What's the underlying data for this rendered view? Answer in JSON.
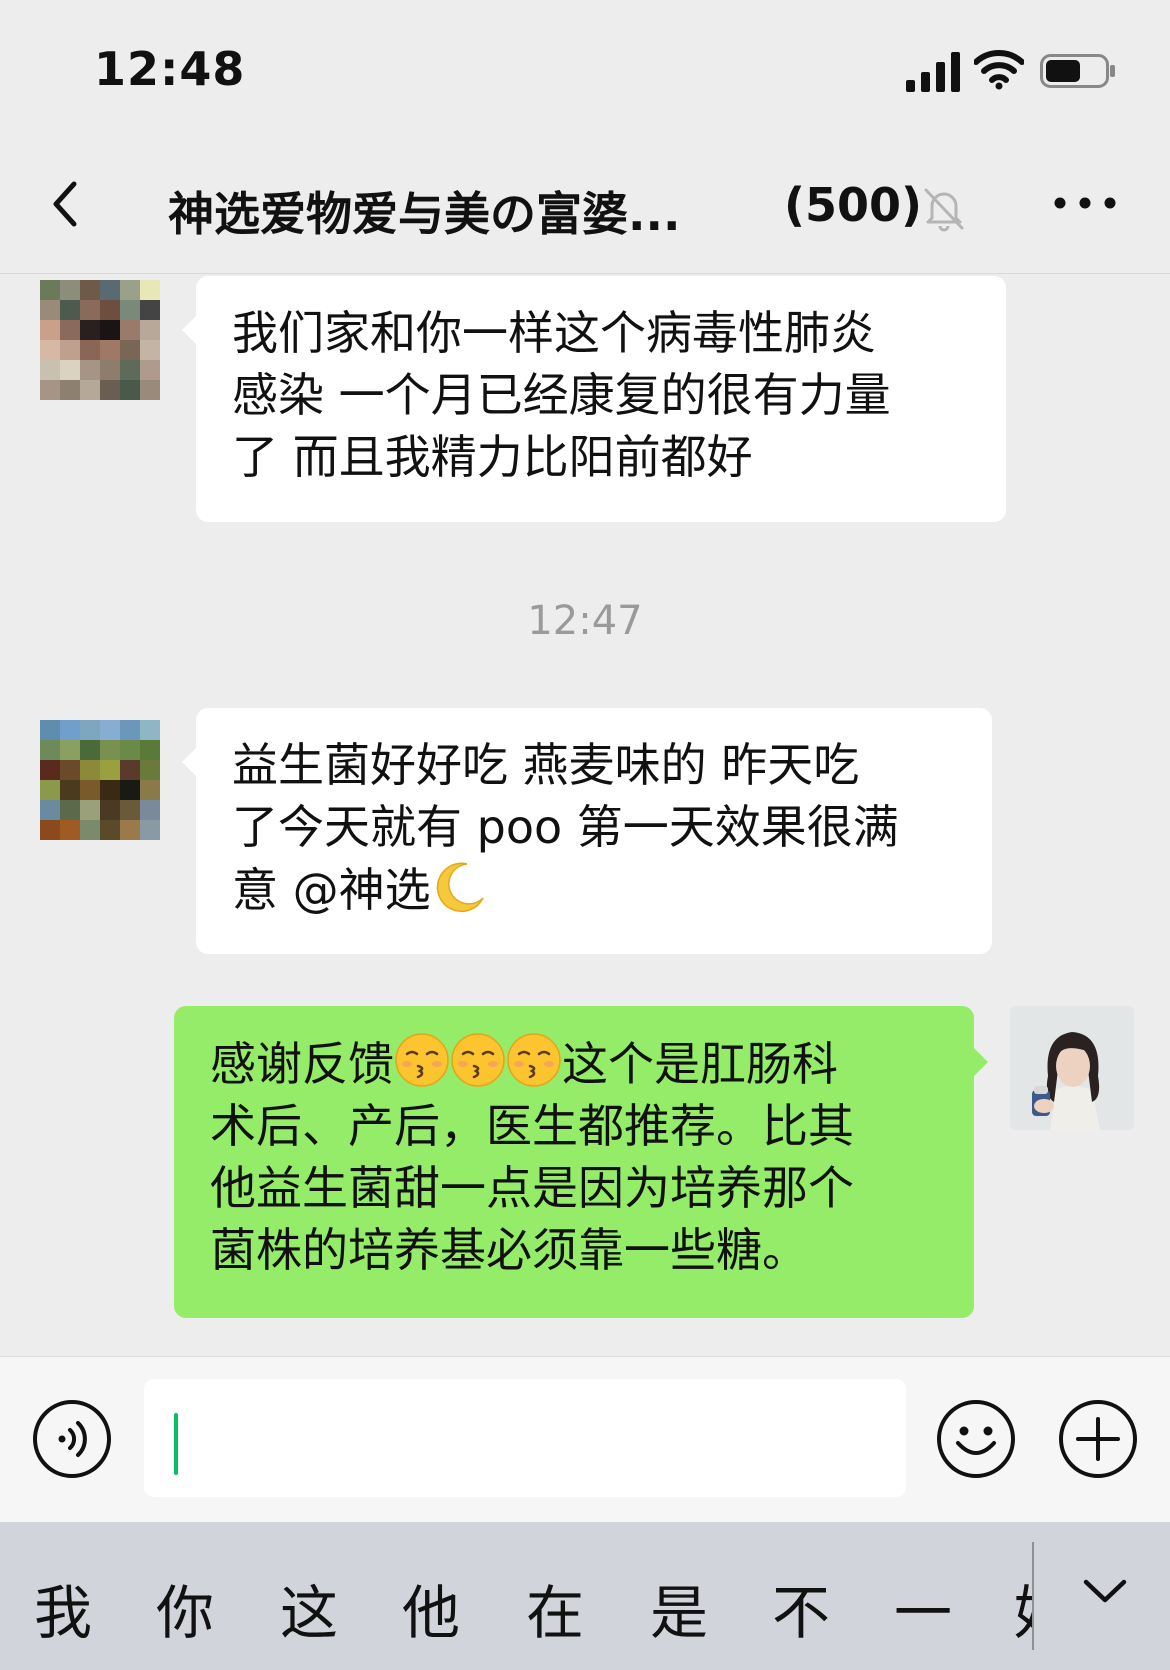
{
  "status_bar": {
    "time": "12:48"
  },
  "nav": {
    "title": "神选爱物爱与美の富婆...",
    "member_count": "(500)"
  },
  "messages": [
    {
      "side": "left",
      "lines": [
        "我们家和你一样这个病毒性肺炎",
        "感染 一个月已经康复的很有力量",
        "了 而且我精力比阳前都好"
      ]
    },
    {
      "side": "left",
      "lines": [
        "益生菌好好吃 燕麦味的 昨天吃",
        "了今天就有 poo 第一天效果很满",
        "意 @神选"
      ]
    },
    {
      "side": "right",
      "line1_text": "感谢反馈",
      "line1_after": "这个是肛肠科",
      "lines": [
        "术后、产后，医生都推荐。比其",
        "他益生菌甜一点是因为培养那个",
        "菌株的培养基必须靠一些糖。"
      ]
    }
  ],
  "timestamp": "12:47",
  "suggestions": [
    "我",
    "你",
    "这",
    "他",
    "在",
    "是",
    "不",
    "一",
    "好"
  ],
  "colors": {
    "background": "#ededed",
    "self_bubble": "#95ec69",
    "other_bubble": "#ffffff",
    "caret": "#07c160",
    "suggest_bar": "#d1d4da"
  },
  "icons": [
    "back-icon",
    "mute-icon",
    "more-icon",
    "voice-icon",
    "emoji-icon",
    "plus-icon",
    "collapse-icon",
    "kissing-face-emoji",
    "crescent-moon-emoji"
  ]
}
